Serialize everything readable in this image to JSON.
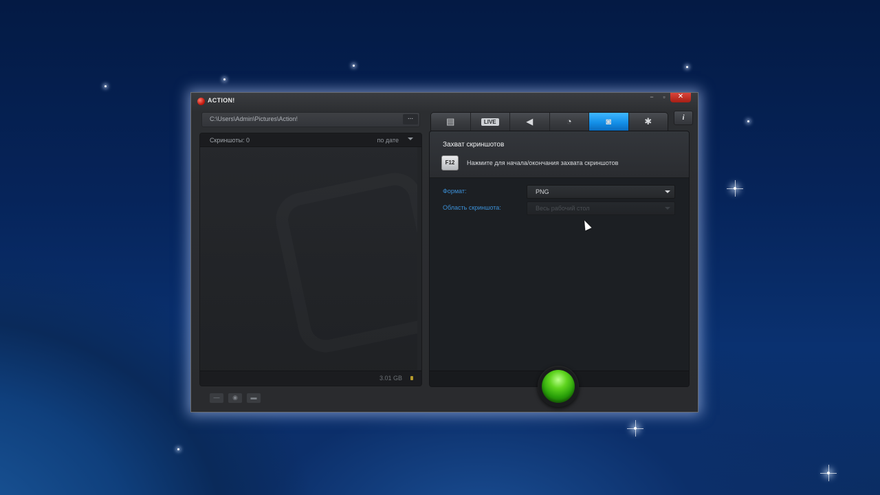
{
  "window": {
    "title": "ACTION!",
    "controls": {
      "minimize": "−",
      "maximize": "▫",
      "close": "✕"
    }
  },
  "left": {
    "path": "C:\\Users\\Admin\\Pictures\\Action!",
    "path_button": "...",
    "screenshots_count": "Скриншоты: 0",
    "sort_label": "по дате",
    "disk_free": "3.01 GB"
  },
  "tabs": [
    {
      "name": "video",
      "icon": "film-icon"
    },
    {
      "name": "live",
      "label": "LIVE"
    },
    {
      "name": "audio",
      "icon": "speaker-icon"
    },
    {
      "name": "benchmark",
      "icon": "stopwatch-icon"
    },
    {
      "name": "screenshot",
      "icon": "camera-icon",
      "active": true
    },
    {
      "name": "settings",
      "icon": "gear-icon"
    }
  ],
  "info_button": "i",
  "screenshot_panel": {
    "title": "Захват скриншотов",
    "hotkey": "F12",
    "hotkey_hint": "Нажмите для начала/окончания захвата скриншотов",
    "format_label": "Формат:",
    "format_value": "PNG",
    "area_label": "Область скриншота:",
    "area_value": "Весь рабочий стол"
  },
  "colors": {
    "accent": "#1490e8",
    "record": "#2aa10a",
    "label": "#3b8fd6"
  }
}
